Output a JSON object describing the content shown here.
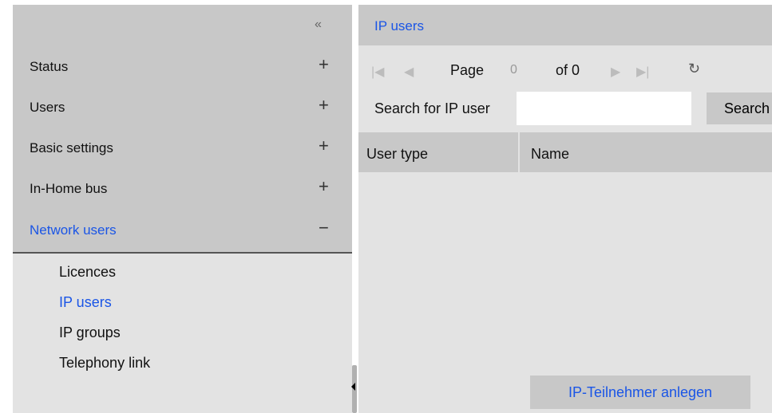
{
  "sidebar": {
    "collapse_glyph": "«",
    "items": [
      {
        "label": "Status",
        "sign": "+"
      },
      {
        "label": "Users",
        "sign": "+"
      },
      {
        "label": "Basic settings",
        "sign": "+"
      },
      {
        "label": "In-Home bus",
        "sign": "+"
      },
      {
        "label": "Network users",
        "sign": "−"
      }
    ],
    "subitems": [
      {
        "label": "Licences"
      },
      {
        "label": "IP users"
      },
      {
        "label": "IP groups"
      },
      {
        "label": "Telephony link"
      }
    ]
  },
  "main": {
    "title": "IP users",
    "pager": {
      "first_icon": "first-page-icon",
      "prev_icon": "previous-page-icon",
      "next_icon": "next-page-icon",
      "last_icon": "last-page-icon",
      "refresh_icon": "refresh-icon",
      "page_label": "Page",
      "page_value": "0",
      "of_label": "of 0"
    },
    "search": {
      "label": "Search for IP user",
      "value": "",
      "button_label": "Search"
    },
    "table": {
      "columns": [
        "User type",
        "Name"
      ],
      "rows": []
    },
    "create_button": "IP-Teilnehmer anlegen"
  },
  "colors": {
    "accent": "#1a55e6",
    "panel": "#e3e3e3",
    "header": "#c8c8c8"
  }
}
